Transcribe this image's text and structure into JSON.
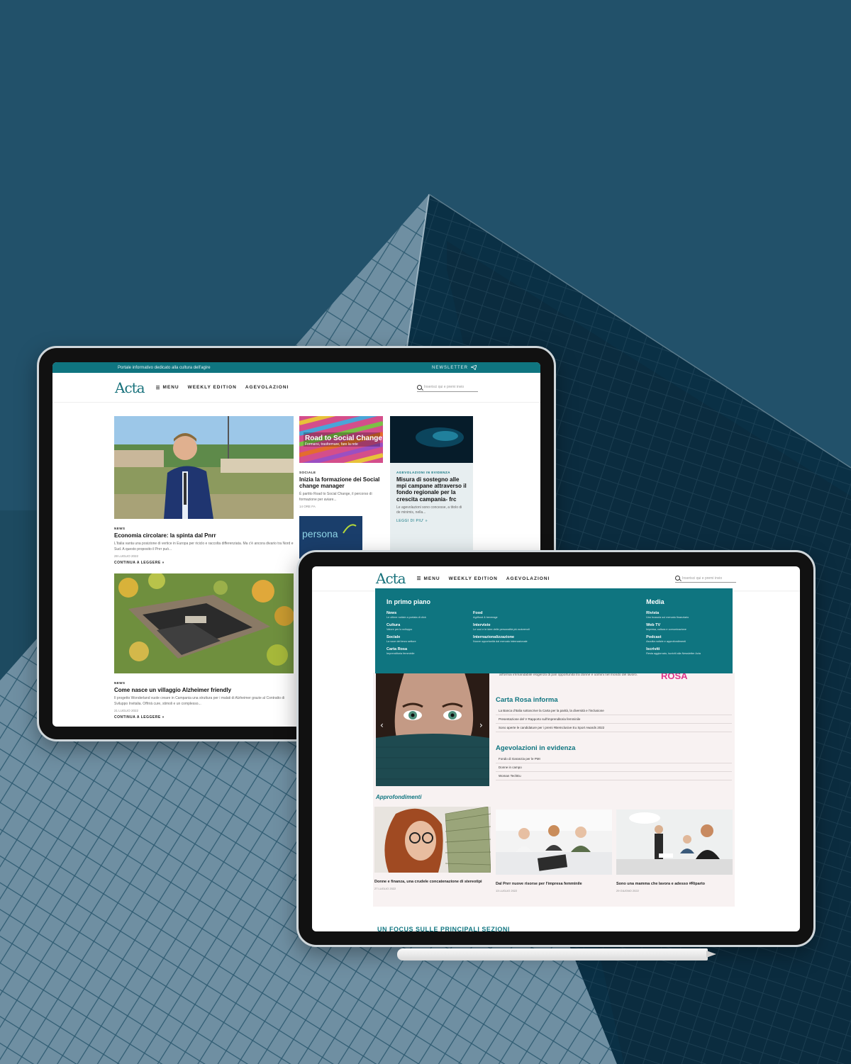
{
  "colors": {
    "background": "#0b3347",
    "accent": "#0f7580",
    "pink": "#e0338a"
  },
  "site1": {
    "topbar_text": "Portale informativo dedicato alla cultura dell'agire",
    "newsletter": "NEWSLETTER",
    "logo": "Acta",
    "nav": [
      "MENU",
      "WEEKLY EDITION",
      "AGEVOLAZIONI"
    ],
    "search_placeholder": "Inserisci qui e premi invio",
    "articles": [
      {
        "tag": "NEWS",
        "title": "Economia circolare: la spinta dal Pnrr",
        "excerpt": "L'Italia vanta una posizione di vertice in Europa per riciclo e raccolta differenziata. Ma c'è ancora divario tra Nord e Sud. A questo proposito il Pnrr può...",
        "date": "28 LUGLIO 2022",
        "more": "CONTINUA A LEGGERE »"
      },
      {
        "tag": "SOCIALE",
        "title": "Inizia la formazione dei Social change manager",
        "excerpt": "È partito Road to Social Change, il percorso di formazione per aviare...",
        "date": "14 ORE FA",
        "image_title": "Road to Social Change",
        "image_sub": "Formarsi, trasformare, fare la rete"
      },
      {
        "tag": "AGEVOLAZIONI IN EVIDENZA",
        "title": "Misura di sostegno alle mpi campane attraverso il fondo regionale per la crescita campania- frc",
        "excerpt": "Le agevolazioni sono concesse, a titolo di de minimis, nella...",
        "more": "LEGGI DI PIU' »"
      },
      {
        "tag": "NEWS",
        "title": "Come nasce un villaggio Alzheimer friendly",
        "excerpt": "Il progetto Wonderland vuole creare in Campania una struttura per i malati di Alzheimer grazie al Contratto di Sviluppo Invitalia. Offrirà cure, stimoli e un complesso...",
        "date": "21 LUGLIO 2022",
        "more": "CONTINUA A LEGGERE »"
      },
      {
        "image_title": "persona"
      }
    ]
  },
  "site2": {
    "logo": "Acta",
    "nav": [
      "MENU",
      "WEEKLY EDITION",
      "AGEVOLAZIONI"
    ],
    "search_placeholder": "Inserisci qui e premi invio",
    "mega": {
      "col1_title": "In primo piano",
      "col1": [
        {
          "label": "News",
          "sub": "Le ultime notizie a portata di click"
        },
        {
          "label": "Cultura",
          "sub": "Valore per lo sviluppo"
        },
        {
          "label": "Sociale",
          "sub": "La voce del terzo settore"
        },
        {
          "label": "Carta Rosa",
          "sub": "Imprenditoria femminile"
        }
      ],
      "col2": [
        {
          "label": "Food",
          "sub": "Agrifood & beverage"
        },
        {
          "label": "Interviste",
          "sub": "Le voci e le idee delle personalità più autorevoli"
        },
        {
          "label": "Internazionalizzazione",
          "sub": "Nuove opportunità dal mercato internazionale"
        }
      ],
      "col4_title": "Media",
      "col4": [
        {
          "label": "Rivista",
          "sub": "Uno bussola sul mercato finanziario"
        },
        {
          "label": "Web TV",
          "sub": "Impresa, cultura e comunicazione"
        },
        {
          "label": "Podcast",
          "sub": "Ascolta notizie e approfondimenti"
        },
        {
          "label": "Iscriviti",
          "sub": "Resta aggiornato, iscriviti alla Newsletter Acta"
        }
      ]
    },
    "intro_text": "all'ormai irrimandabile esigenza di pari opportunità tra donne e uomini nel mondo del lavoro.",
    "rosa": "ROSA",
    "carta_rosa_title": "Carta Rosa informa",
    "carta_rosa_items": [
      "La Banca d'Italia sottoscrive la Carta per la parità, la diversità e l'inclusione",
      "Presentazione del V Rapporto sull'imprenditoria femminile",
      "Sono aperte le candidature per i premi #BeInclusive Eu Sport Awards 2022"
    ],
    "agevolazioni_title": "Agevolazioni in evidenza",
    "agevolazioni_items": [
      "Fondo di Garanzia per le PMI",
      "Donne in campo",
      "Woman TechEu"
    ],
    "approfondimenti": "Approfondimenti",
    "cards": [
      {
        "title": "Donne e finanza, una crudele concatenazione di stereotipi",
        "date": "27 LUGLIO 2022"
      },
      {
        "title": "Dal Pnrr nuove risorse per l'impresa femminile",
        "date": "13 LUGLIO 2022"
      },
      {
        "title": "Sono una mamma che lavora e adesso #Riparto",
        "date": "29 GIUGNO 2022"
      }
    ],
    "focus": "UN FOCUS SULLE PRINCIPALI SEZIONI"
  }
}
